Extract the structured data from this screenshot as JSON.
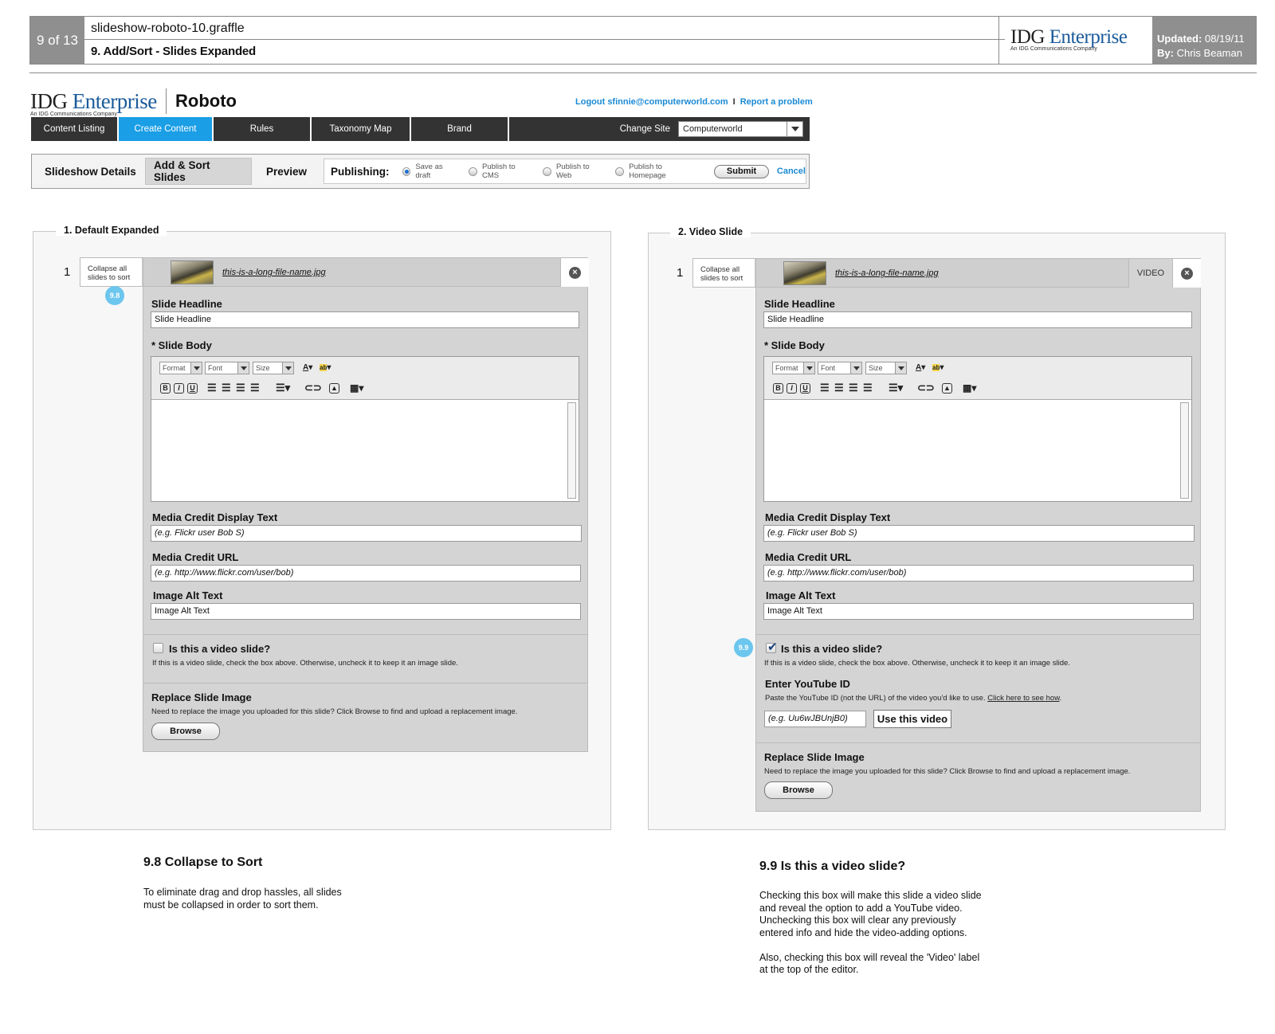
{
  "doc": {
    "page_num": "9 of 13",
    "file_name": "slideshow-roboto-10.graffle",
    "subtitle": "9. Add/Sort - Slides Expanded",
    "logo_idg": "IDG",
    "logo_enterprise": "Enterprise",
    "logo_sub": "An IDG Communications Company",
    "updated_label": "Updated:",
    "updated_value": "08/19/11",
    "by_label": "By:",
    "by_value": "Chris Beaman"
  },
  "app": {
    "logo_idg": "IDG",
    "logo_enterprise": "Enterprise",
    "logo_sub": "An IDG Communications Company",
    "name": "Roboto",
    "logout": "Logout sfinnie@computerworld.com",
    "separator": "I",
    "report": "Report a problem"
  },
  "nav": {
    "items": [
      "Content Listing",
      "Create Content",
      "Rules",
      "Taxonomy Map",
      "Brand"
    ],
    "change_site_label": "Change Site",
    "site_value": "Computerworld"
  },
  "subnav": {
    "tabs": [
      "Slideshow Details",
      "Add & Sort Slides",
      "Preview"
    ],
    "publishing_label": "Publishing:",
    "options": [
      "Save as draft",
      "Publish to CMS",
      "Publish to Web",
      "Publish to Homepage"
    ],
    "submit": "Submit",
    "cancel": "Cancel"
  },
  "panel1": {
    "title": "1. Default Expanded",
    "slide_num": "1",
    "collapse_text": "Collapse all slides to sort",
    "callout": "9.8",
    "file_name": "this-is-a-long-file-name.jpg",
    "close": "×",
    "headline_label": "Slide Headline",
    "headline_value": "Slide Headline",
    "body_label": "* Slide Body",
    "rte": {
      "format": "Format",
      "font": "Font",
      "size": "Size"
    },
    "credit_label": "Media Credit Display Text",
    "credit_placeholder": "(e.g. Flickr user Bob S)",
    "credit_url_label": "Media Credit URL",
    "credit_url_placeholder": "(e.g. http://www.flickr.com/user/bob)",
    "alt_label": "Image Alt Text",
    "alt_value": "Image Alt Text",
    "video_question": "Is this a video slide?",
    "video_help": "If this is a video slide, check the box above. Otherwise, uncheck it to keep it an image slide.",
    "replace_label": "Replace Slide Image",
    "replace_help": "Need to replace the image you uploaded for this slide? Click Browse to find and upload a replacement image.",
    "browse": "Browse"
  },
  "panel2": {
    "title": "2. Video Slide",
    "slide_num": "1",
    "collapse_text": "Collapse all slides to sort",
    "callout": "9.9",
    "file_name": "this-is-a-long-file-name.jpg",
    "video_label": "VIDEO",
    "close": "×",
    "headline_label": "Slide Headline",
    "headline_value": "Slide Headline",
    "body_label": "* Slide Body",
    "rte": {
      "format": "Format",
      "font": "Font",
      "size": "Size"
    },
    "credit_label": "Media Credit Display Text",
    "credit_placeholder": "(e.g. Flickr user Bob S)",
    "credit_url_label": "Media Credit URL",
    "credit_url_placeholder": "(e.g. http://www.flickr.com/user/bob)",
    "alt_label": "Image Alt Text",
    "alt_value": "Image Alt Text",
    "video_question": "Is this a video slide?",
    "video_help": "If this is a video slide, check the box above. Otherwise, uncheck it to keep it an image slide.",
    "youtube_label": "Enter YouTube ID",
    "youtube_help": "Paste the YouTube ID (not the URL) of the video you'd like to use.",
    "youtube_link": "Click here to see how",
    "youtube_period": ".",
    "youtube_placeholder": "(e.g. Uu6wJBUnjB0)",
    "use_video": "Use this video",
    "replace_label": "Replace Slide Image",
    "replace_help": "Need to replace the image you uploaded for this slide? Click Browse to find and upload a replacement image.",
    "browse": "Browse"
  },
  "notes": {
    "n1_title": "9.8 Collapse to Sort",
    "n1_lines": [
      "To eliminate drag and drop hassles, all slides",
      "must be collapsed in order to sort them."
    ],
    "n2_title": "9.9 Is this a video slide?",
    "n2_lines": [
      "Checking this box will make this slide a video slide",
      "and reveal the option to add a YouTube video.",
      "Unchecking this box will clear any previously",
      "entered info and hide the video-adding options.",
      "",
      "Also, checking this box will reveal the 'Video' label",
      "at the top of the editor."
    ]
  }
}
